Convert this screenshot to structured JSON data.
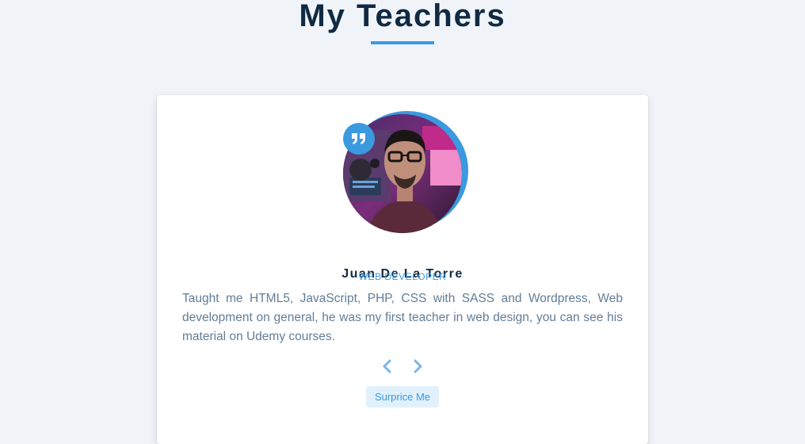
{
  "header": {
    "title": "My Teachers"
  },
  "review": {
    "name": "Juan De La Torre",
    "job": "WEB DEVELOPER",
    "text": "Taught me HTML5, JavaScript, PHP, CSS with SASS and Wordpress, Web development on general, he was my first teacher in web design, you can see his material on Udemy courses.",
    "avatar_alt": "Juan De La Torre",
    "quote_icon": "quote-right-icon",
    "prev_icon": "chevron-left-icon",
    "next_icon": "chevron-right-icon",
    "random_button_label": "Surprice Me"
  },
  "colors": {
    "background": "#f0f4f8",
    "title": "#102a43",
    "accent": "#3b99e0",
    "text": "#627d98",
    "button_bg": "#e0f1fc",
    "card": "#ffffff"
  }
}
